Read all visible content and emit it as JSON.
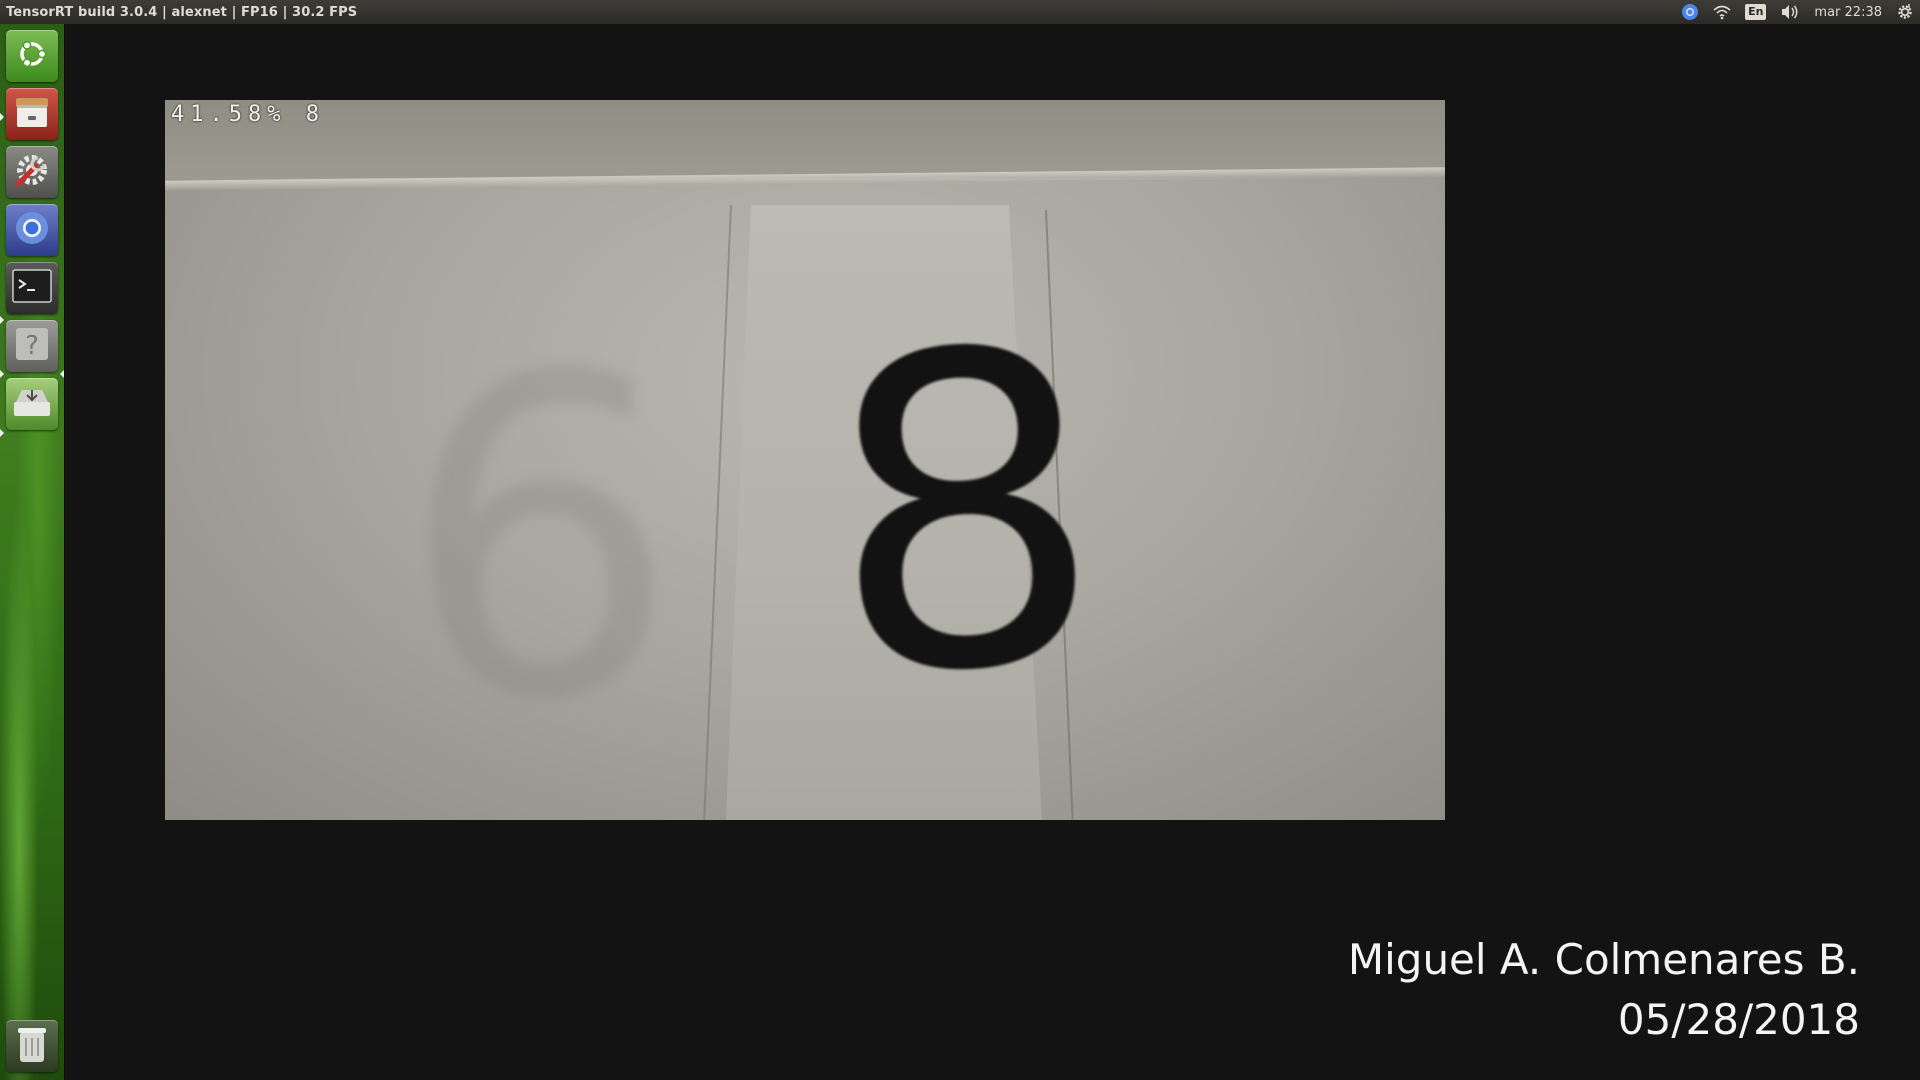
{
  "top_panel": {
    "window_title": "TensorRT build 3.0.4 | alexnet | FP16 | 30.2 FPS",
    "indicators": {
      "chrome_icon": "chrome-indicator-icon",
      "wifi_icon": "wifi-icon",
      "language": "En",
      "volume_icon": "volume-icon",
      "clock": "mar 22:38",
      "settings_icon": "gear-icon"
    }
  },
  "launcher": {
    "items": [
      {
        "name": "dash-home",
        "icon": "ubuntu-logo-icon"
      },
      {
        "name": "files",
        "icon": "file-cabinet-icon"
      },
      {
        "name": "system-settings",
        "icon": "wrench-gear-icon"
      },
      {
        "name": "chromium",
        "icon": "chromium-icon"
      },
      {
        "name": "terminal",
        "icon": "terminal-icon"
      },
      {
        "name": "help",
        "icon": "question-icon"
      },
      {
        "name": "software-updater",
        "icon": "installer-icon"
      },
      {
        "name": "trash",
        "icon": "trash-icon"
      }
    ]
  },
  "camera": {
    "overlay": "41.58% 8",
    "digit_on_paper": "8"
  },
  "credit": {
    "author": "Miguel A. Colmenares B.",
    "date": "05/28/2018"
  },
  "colors": {
    "launcher_green": "#3f7d1f",
    "panel_bg": "#2b2a27",
    "background": "#131313"
  }
}
